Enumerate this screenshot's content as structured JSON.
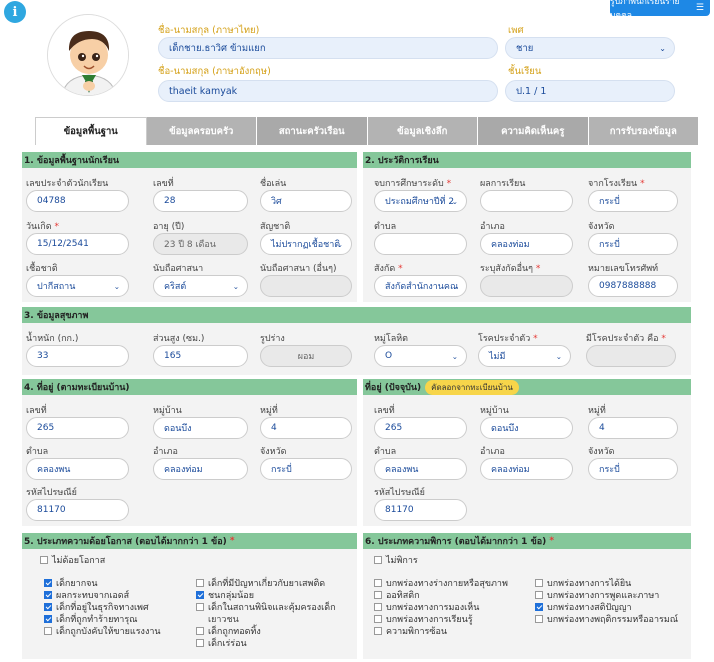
{
  "header": {
    "info_icon": "i",
    "top_button_label": "รูปภาพนักเรียนรายบุคคล",
    "name_th_label": "ชื่อ-นามสกุล (ภาษาไทย)",
    "name_th_value": "เด็กชาย.ธาวิศ ข้ามแยก",
    "name_en_label": "ชื่อ-นามสกุล (ภาษาอังกฤษ)",
    "name_en_value": "thaeit kamyak",
    "gender_label": "เพศ",
    "gender_value": "ชาย",
    "class_label": "ชั้นเรียน",
    "class_value": "ป.1 / 1"
  },
  "tabs": [
    "ข้อมูลพื้นฐาน",
    "ข้อมูลครอบครัว",
    "สถานะครัวเรือน",
    "ข้อมูลเชิงลึก",
    "ความคิดเห็นครู",
    "การรับรองข้อมูล"
  ],
  "s1": {
    "title": "1. ข้อมูลพื้นฐานนักเรียน",
    "student_id_label": "เลขประจำตัวนักเรียน",
    "student_id": "04788",
    "number_label": "เลขที่",
    "number": "28",
    "nickname_label": "ชื่อเล่น",
    "nickname": "วิศ",
    "birthdate_label": "วันเกิด",
    "birthdate": "15/12/2541",
    "age_label": "อายุ (ปี)",
    "age": "23 ปี 8 เดือน",
    "nationality_label": "สัญชาติ",
    "nationality": "ไม่ปรากฏเชื้อชาติ",
    "race_label": "เชื้อชาติ",
    "race": "ปากีสถาน",
    "religion_label": "นับถือศาสนา",
    "religion": "คริสต์",
    "religion_other_label": "นับถือศาสนา (อื่นๆ)",
    "religion_other": ""
  },
  "s2": {
    "title": "2. ประวัติการเรียน",
    "edu_level_label": "จบการศึกษาระดับ",
    "edu_level": "ประถมศึกษาปีที่ 2",
    "result_label": "ผลการเรียน",
    "result": "",
    "from_school_label": "จากโรงเรียน",
    "from_school": "กระบี่",
    "subdistrict_label": "ตำบล",
    "subdistrict": "",
    "district_label": "อำเภอ",
    "district": "คลองท่อม",
    "province_label": "จังหวัด",
    "province": "กระบี่",
    "affiliation_label": "สังกัด",
    "affiliation": "สังกัดสำนักงานคณ",
    "affiliation_other_label": "ระบุสังกัดอื่นๆ",
    "affiliation_other": "",
    "phone_label": "หมายเลขโทรศัพท์",
    "phone": "0987888888"
  },
  "s3": {
    "title": "3. ข้อมูลสุขภาพ",
    "weight_label": "น้ำหนัก (กก.)",
    "weight": "33",
    "height_label": "ส่วนสูง (ซม.)",
    "height": "165",
    "shape_label": "รูปร่าง",
    "shape": "ผอม",
    "blood_label": "หมู่โลหิต",
    "blood": "O",
    "disease_label": "โรคประจำตัว",
    "disease": "ไม่มี",
    "disease_is_label": "มีโรคประจำตัว คือ",
    "disease_is": ""
  },
  "s4": {
    "title": "4. ที่อยู่ (ตามทะเบียนบ้าน)",
    "house_no_label": "เลขที่",
    "house_no": "265",
    "village_label": "หมู่บ้าน",
    "village": "ดอนบึง",
    "moo_label": "หมู่ที่",
    "moo": "4",
    "tambon_label": "ตำบล",
    "tambon": "คลองพน",
    "amphoe_label": "อำเภอ",
    "amphoe": "คลองท่อม",
    "province_label": "จังหวัด",
    "province": "กระบี่",
    "postcode_label": "รหัสไปรษณีย์",
    "postcode": "81170"
  },
  "s4b": {
    "title": "ที่อยู่ (ปัจจุบัน)",
    "copy_label": "คัดลอกจากทะเบียนบ้าน",
    "house_no_label": "เลขที่",
    "house_no": "265",
    "village_label": "หมู่บ้าน",
    "village": "ดอนบึง",
    "moo_label": "หมู่ที่",
    "moo": "4",
    "tambon_label": "ตำบล",
    "tambon": "คลองพน",
    "amphoe_label": "อำเภอ",
    "amphoe": "คลองท่อม",
    "province_label": "จังหวัด",
    "province": "กระบี่",
    "postcode_label": "รหัสไปรษณีย์",
    "postcode": "81170"
  },
  "s5": {
    "title": "5. ประเภทความด้อยโอกาส (ตอบได้มากกว่า 1 ข้อ)",
    "none": "ไม่ด้อยโอกาส",
    "col1": [
      "เด็กยากจน",
      "ผลกระทบจากเอดส์",
      "เด็กที่อยู่ในธุรกิจทางเพศ",
      "เด็กที่ถูกทำร้ายทารุณ",
      "เด็กถูกบังคับให้ขายแรงงาน"
    ],
    "col2": [
      "เด็กที่มีปัญหาเกี่ยวกับยาเสพติด",
      "ชนกลุ่มน้อย",
      "เด็กในสถานพินิจและคุ้มครองเด็ก",
      "เยาวชน",
      "เด็กถูกทอดทิ้ง",
      "เด็กเร่ร่อน"
    ]
  },
  "s6": {
    "title": "6. ประเภทความพิการ (ตอบได้มากกว่า 1 ข้อ)",
    "none": "ไม่พิการ",
    "col1": [
      "บกพร่องทางร่างกายหรือสุขภาพ",
      "ออทิสติก",
      "บกพร่องทางการมองเห็น",
      "บกพร่องทางการเรียนรู้",
      "ความพิการซ้อน"
    ],
    "col2": [
      "บกพร่องทางการได้ยิน",
      "บกพร่องทางการพูดและภาษา",
      "บกพร่องทางสติปัญญา",
      "บกพร่องทางพฤติกรรมหรืออารมณ์"
    ]
  },
  "colors": {
    "section_header": "#85c79a",
    "accent": "#1e6fd9",
    "label_gold": "#d4a017"
  }
}
